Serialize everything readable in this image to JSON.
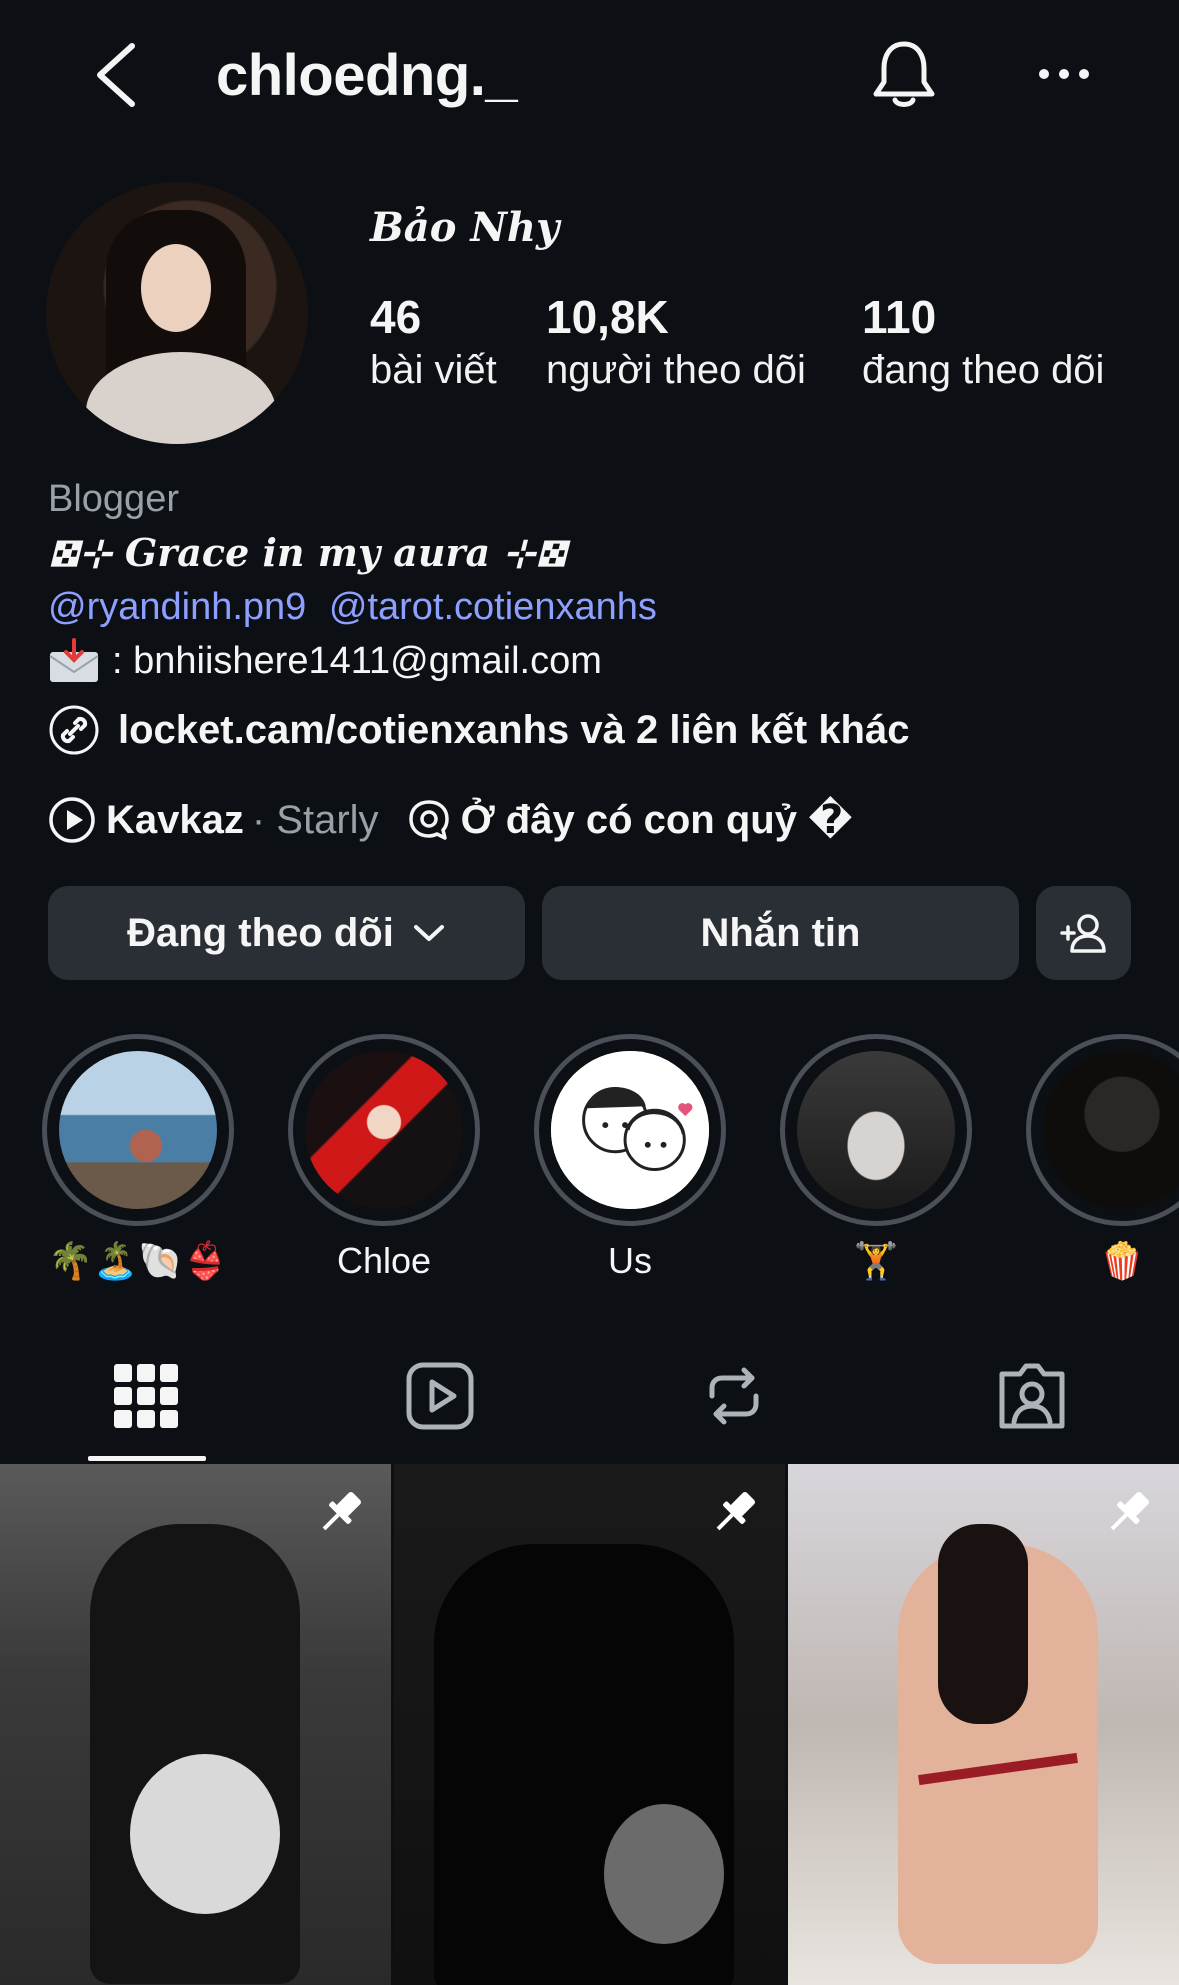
{
  "header": {
    "username": "chloedng._"
  },
  "profile": {
    "display_name": "Bảo Nhy",
    "stats": [
      {
        "value": "46",
        "label": "bài viết"
      },
      {
        "value": "10,8K",
        "label": "người theo dõi"
      },
      {
        "value": "110",
        "label": "đang theo dõi"
      }
    ]
  },
  "bio": {
    "category": "Blogger",
    "tagline": "𖣯⊹ 𝑮𝒓𝒂𝒄𝒆 𝒊𝒏 𝒎𝒚 𝒂𝒖𝒓𝒂 ⊹𖣯",
    "mentions": [
      "@ryandinh.pn9",
      "@tarot.cotienxanhs"
    ],
    "email": ": bnhiishere1411@gmail.com",
    "link": "locket.cam/cotienxanhs và 2 liên kết khác",
    "music": {
      "song": "Kavkaz",
      "artist": "· Starly"
    },
    "thread_note": "Ở đây có con quỷ �"
  },
  "actions": {
    "follow_label": "Đang theo dõi",
    "message_label": "Nhắn tin"
  },
  "highlights": [
    {
      "label": "🌴🏝️🐚👙"
    },
    {
      "label": "Chloe"
    },
    {
      "label": "Us"
    },
    {
      "label": "🏋️"
    },
    {
      "label": "🍿"
    }
  ],
  "tabs": [
    "grid-icon",
    "reels-icon",
    "reposts-icon",
    "tagged-icon"
  ],
  "colors": {
    "background": "#0c0f14",
    "button": "#2a2f36",
    "mention": "#8ea0ff",
    "muted": "#9aa0a8"
  }
}
